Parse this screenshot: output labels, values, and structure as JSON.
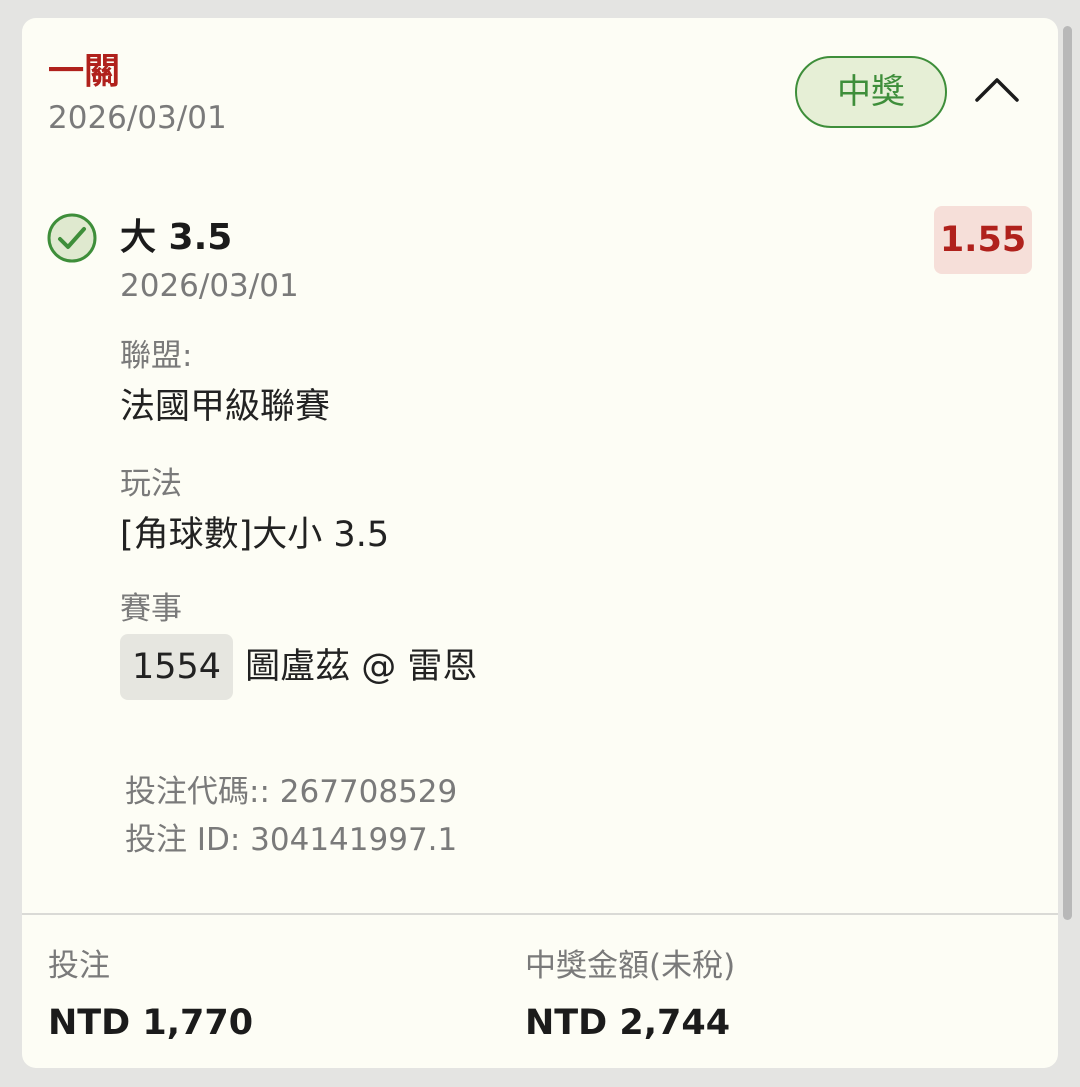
{
  "header": {
    "title": "一關",
    "date": "2026/03/01",
    "status_badge": "中獎"
  },
  "selection": {
    "name": "大 3.5",
    "date": "2026/03/01",
    "odds": "1.55",
    "league_label": "聯盟:",
    "league": "法國甲級聯賽",
    "market_label": "玩法",
    "market": "[角球數]大小 3.5",
    "event_label": "賽事",
    "match_number": "1554",
    "teams": "圖盧茲 @ 雷恩"
  },
  "bet_info": {
    "code_line": "投注代碼:: 267708529",
    "id_line": "投注 ID: 304141997.1"
  },
  "footer": {
    "stake_label": "投注",
    "stake_value": "NTD 1,770",
    "payout_label": "中獎金額(未稅)",
    "payout_value": "NTD 2,744"
  },
  "colors": {
    "accent_red": "#b0211c",
    "win_green": "#3e8e3a",
    "card_bg": "#fdfdf5"
  },
  "icons": {
    "collapse": "chevron-up-icon",
    "result": "check-circle-icon"
  }
}
